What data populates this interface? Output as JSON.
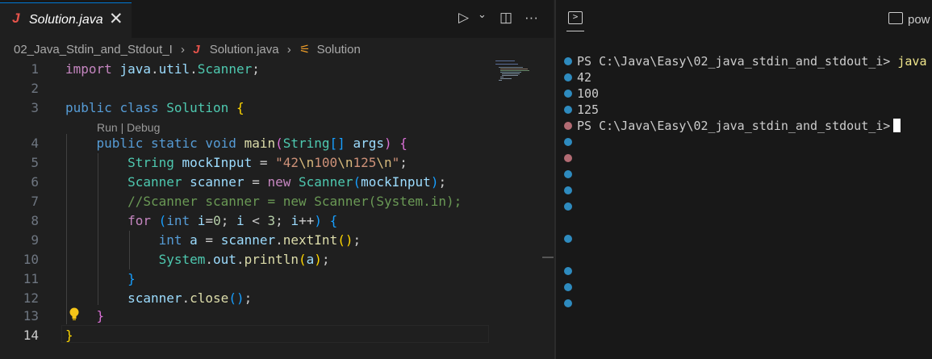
{
  "editor": {
    "tab": {
      "icon": "java-icon",
      "icon_text": "J",
      "label": "Solution.java",
      "close": "✕"
    },
    "actions": {
      "run": "▷",
      "run_dropdown": "⌄",
      "split": "◫",
      "more": "···"
    },
    "breadcrumb": {
      "folder": "02_Java_Stdin_and_Stdout_I",
      "file_icon": "J",
      "file": "Solution.java",
      "symbol_icon": "⚟",
      "symbol": "Solution",
      "separator": "›"
    },
    "codelens": "Run | Debug",
    "line_numbers": [
      "1",
      "2",
      "3",
      "4",
      "5",
      "6",
      "7",
      "8",
      "9",
      "10",
      "11",
      "12",
      "13",
      "14"
    ],
    "current_line": "14"
  },
  "terminal": {
    "icon": "terminal-icon",
    "icon_text": ">",
    "shell_label": "pow",
    "lines": [
      {
        "prompt": "PS C:\\Java\\Easy\\02_java_stdin_and_stdout_i>",
        "command": " java",
        "status": "ok"
      },
      {
        "text": "42",
        "status": "ok"
      },
      {
        "text": "100",
        "status": "ok"
      },
      {
        "text": "125",
        "status": "ok"
      },
      {
        "prompt": "PS C:\\Java\\Easy\\02_java_stdin_and_stdout_i>",
        "command": "",
        "status": "err"
      }
    ]
  },
  "colors": {
    "accent": "#0078d4",
    "keyword": "#c586c0",
    "type": "#569cd6",
    "class": "#4ec9b0",
    "string": "#ce9178",
    "comment": "#6a9955",
    "dot_ok": "#2e8bbf",
    "dot_err": "#b26b73"
  }
}
